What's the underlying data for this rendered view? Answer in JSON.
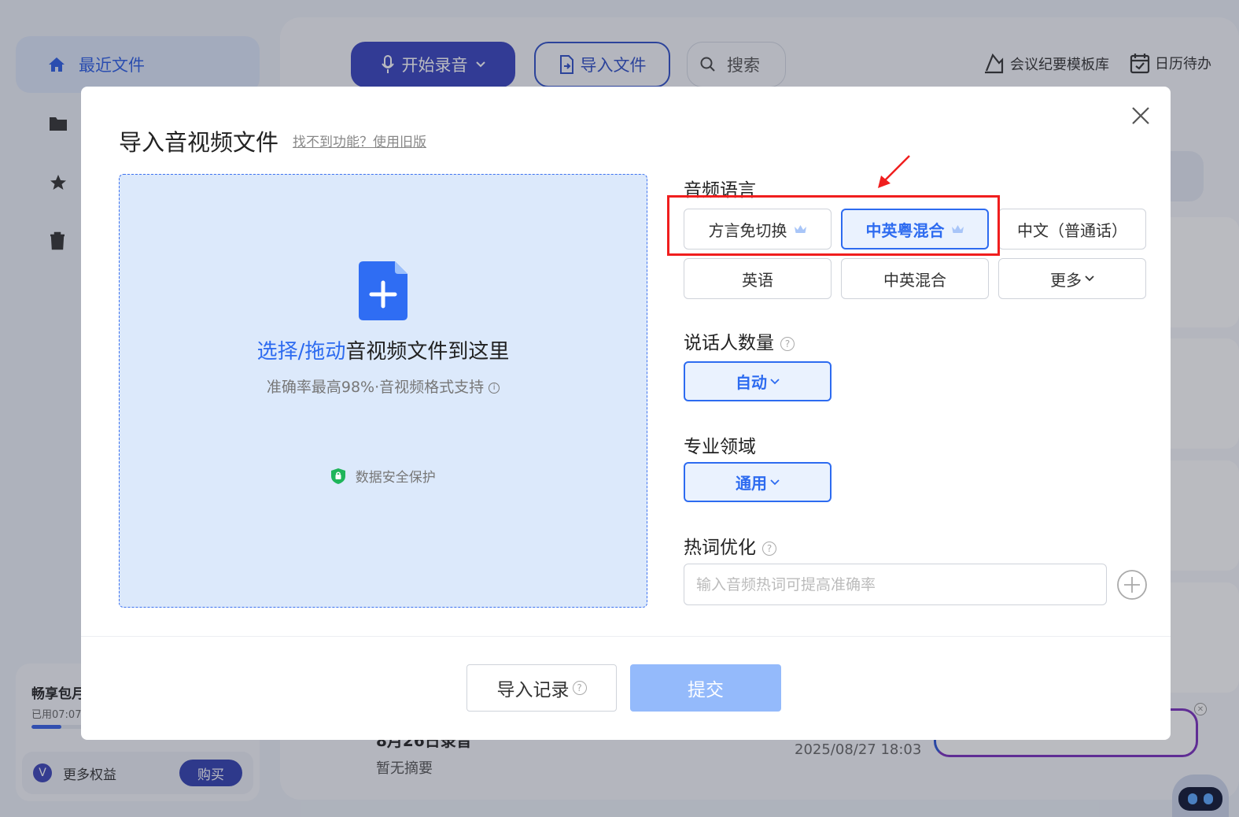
{
  "sidebar": {
    "active_item": "最近文件",
    "promo": {
      "title": "畅享包月",
      "usage_text": "已用07:07",
      "usage_fraction": 0.14,
      "more_rights": "更多权益",
      "buy": "购买"
    }
  },
  "toolbar": {
    "record": "开始录音",
    "import": "导入文件",
    "search": "搜索",
    "template_lib": "会议纪要模板库",
    "calendar": "日历待办"
  },
  "list_row": {
    "title": "8月26日录音",
    "summary": "暂无摘要",
    "date": "2025/08/27 18:03"
  },
  "modal": {
    "title": "导入音视频文件",
    "old_link": "找不到功能？使用旧版",
    "dropzone": {
      "highlight": "选择/拖动",
      "rest": "音视频文件到这里",
      "sub": "准确率最高98%·音视频格式支持",
      "security": "数据安全保护"
    },
    "audio_lang_label": "音频语言",
    "languages": [
      {
        "label": "方言免切换",
        "premium": true,
        "selected": false
      },
      {
        "label": "中英粤混合",
        "premium": true,
        "selected": true
      },
      {
        "label": "中文（普通话）",
        "premium": false,
        "selected": false
      },
      {
        "label": "英语",
        "premium": false,
        "selected": false
      },
      {
        "label": "中英混合",
        "premium": false,
        "selected": false
      },
      {
        "label": "更多",
        "premium": false,
        "selected": false
      }
    ],
    "speaker_label": "说话人数量",
    "speaker_value": "自动",
    "domain_label": "专业领域",
    "domain_value": "通用",
    "hotword_label": "热词优化",
    "hotword_placeholder": "输入音频热词可提高准确率",
    "history_btn": "导入记录",
    "submit_btn": "提交"
  },
  "colors": {
    "accent": "#2d6bf0",
    "annotation": "#f01e1e",
    "submit_disabled": "#94bafb"
  }
}
